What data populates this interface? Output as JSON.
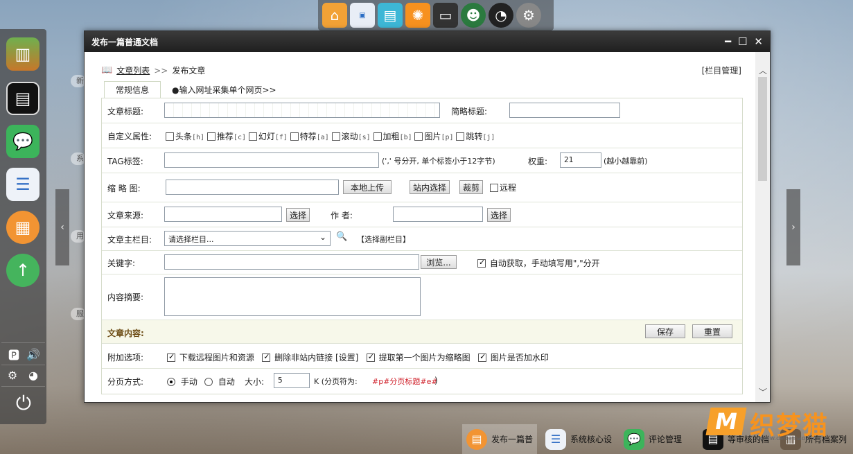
{
  "window": {
    "title": "发布一篇普通文档",
    "controls": {
      "minimize": "━",
      "maximize": "☐",
      "close": "✕"
    }
  },
  "breadcrumb": {
    "list_link": "文章列表",
    "separator": ">>",
    "current": "发布文章"
  },
  "column_manage": "[栏目管理]",
  "tabs": [
    {
      "label": "常规信息"
    },
    {
      "label": "●输入网址采集单个网页>>"
    }
  ],
  "form": {
    "title_label": "文章标题:",
    "title_value": "",
    "short_title_label": "简略标题:",
    "short_title_value": "",
    "custom_attr_label": "自定义属性:",
    "custom_attrs": [
      {
        "name": "头条",
        "code": "[h]"
      },
      {
        "name": "推荐",
        "code": "[c]"
      },
      {
        "name": "幻灯",
        "code": "[f]"
      },
      {
        "name": "特荐",
        "code": "[a]"
      },
      {
        "name": "滚动",
        "code": "[s]"
      },
      {
        "name": "加粗",
        "code": "[b]"
      },
      {
        "name": "图片",
        "code": "[p]"
      },
      {
        "name": "跳转",
        "code": "[j]"
      }
    ],
    "tag_label": "TAG标签:",
    "tag_value": "",
    "tag_hint": "(',' 号分开, 单个标签小于12字节)",
    "weight_label": "权重:",
    "weight_value": "21",
    "weight_hint": "(越小越靠前)",
    "thumb_label": "缩 略 图:",
    "thumb_value": "",
    "local_upload": "本地上传",
    "site_select": "站内选择",
    "crop": "裁剪",
    "remote": "远程",
    "source_label": "文章来源:",
    "source_value": "",
    "select_btn": "选择",
    "author_label": "作 者:",
    "author_value": "",
    "column_label": "文章主栏目:",
    "column_selected": "请选择栏目...",
    "sub_column": "【选择副栏目】",
    "keywords_label": "关键字:",
    "keywords_value": "",
    "browse_btn": "浏览...",
    "auto_fetch": "自动获取，手动填写用\",\"分开",
    "summary_label": "内容摘要:",
    "summary_value": "",
    "content_header": "文章内容:",
    "save_btn": "保存",
    "reset_btn": "重置",
    "extra_label": "附加选项:",
    "extra_options": [
      {
        "label": "下载远程图片和资源",
        "checked": true
      },
      {
        "label": "删除非站内链接",
        "checked": true,
        "extra": "[设置]"
      },
      {
        "label": "提取第一个图片为缩略图",
        "checked": true
      },
      {
        "label": "图片是否加水印",
        "checked": true
      }
    ],
    "page_label": "分页方式:",
    "page_manual": "手动",
    "page_auto": "自动",
    "size_label": "大小:",
    "size_value": "5",
    "size_unit": "K (分页符为:",
    "page_marker": "#p#分页标题#e#",
    "page_end": ")"
  },
  "taskbar": [
    {
      "label": "发布一篇普",
      "icon": "document-icon"
    },
    {
      "label": "系统核心设",
      "icon": "settings-icon"
    },
    {
      "label": "评论管理",
      "icon": "comment-icon"
    },
    {
      "label": "等审核的档",
      "icon": "doc-dark-icon"
    },
    {
      "label": "所有档案列",
      "icon": "doc-list-icon"
    }
  ],
  "brand": {
    "logo_text": "织梦猫",
    "logo_letter": "M",
    "url": "www.dedemao.com"
  },
  "colors": {
    "accent": "#f7931e",
    "titlebar": "#2a2a2a",
    "form_border": "#d6dccb",
    "section_bg": "#f7f8ea"
  }
}
